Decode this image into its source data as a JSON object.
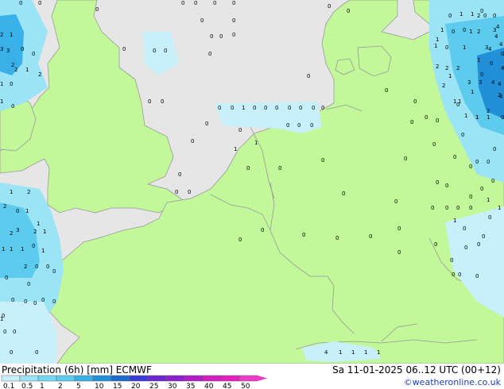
{
  "map": {
    "sea_color": "#e6e6e6",
    "land_color": "#c2f79a",
    "border_color": "#999999",
    "precip_colors": [
      "#c8f0fa",
      "#9be4f5",
      "#5ccbee",
      "#3ab0e8",
      "#2190d8"
    ],
    "values": [
      "0",
      "0",
      "0",
      "0",
      "0",
      "0",
      "0",
      "0",
      "0",
      "0",
      "0",
      "0",
      "0",
      "0",
      "0",
      "0",
      "0",
      "0",
      "0",
      "0",
      "0",
      "1",
      "1",
      "0",
      "0",
      "2",
      "1",
      "3",
      "2",
      "0",
      "0",
      "3",
      "2",
      "1",
      "2",
      "1",
      "0",
      "1",
      "0",
      "0",
      "0",
      "1",
      "0",
      "0",
      "0",
      "0",
      "0",
      "0",
      "0",
      "0",
      "0",
      "0",
      "0",
      "0",
      "0",
      "0",
      "0",
      "0",
      "0",
      "0",
      "0",
      "0",
      "0",
      "0",
      "0",
      "0",
      "0",
      "0",
      "1",
      "0",
      "0",
      "0",
      "0",
      "1",
      "0",
      "2",
      "1",
      "2",
      "1",
      "0",
      "1",
      "2",
      "0",
      "0",
      "0",
      "1",
      "1",
      "1",
      "0",
      "0",
      "0",
      "0",
      "0",
      "0",
      "0",
      "0",
      "0",
      "0",
      "0",
      "0",
      "0",
      "0",
      "0",
      "0",
      "1",
      "2",
      "1",
      "3",
      "2",
      "0",
      "0",
      "0",
      "1",
      "1",
      "0",
      "1",
      "0",
      "0",
      "0",
      "0",
      "0",
      "1",
      "2",
      "2",
      "4",
      "4",
      "1",
      "1",
      "0",
      "0",
      "0",
      "1",
      "1",
      "1",
      "0",
      "0",
      "0",
      "1",
      "1",
      "2",
      "2",
      "2",
      "3",
      "3",
      "4",
      "4",
      "4",
      "3",
      "1",
      "1",
      "1",
      "2",
      "4",
      "4",
      "2",
      "3",
      "1",
      "1",
      "2",
      "4",
      "0",
      "0",
      "0",
      "0",
      "0",
      "0",
      "0",
      "0",
      "0",
      "0",
      "0",
      "0",
      "0",
      "0",
      "0",
      "0",
      "0",
      "0",
      "0",
      "0",
      "4",
      "1",
      "1",
      "1",
      "1",
      "0",
      "1",
      "1"
    ]
  },
  "footer": {
    "title": "Precipitation (6h) [mm] ECMWF",
    "valid_time": "Sa 11-01-2025 06..12 UTC (00+12)",
    "credit": "©weatheronline.co.uk",
    "scale_labels": [
      "0.1",
      "0.5",
      "1",
      "2",
      "5",
      "10",
      "15",
      "20",
      "25",
      "30",
      "35",
      "40",
      "45",
      "50"
    ],
    "scale_colors": [
      "#c8f0fa",
      "#9be4f5",
      "#72d8f2",
      "#5ccbee",
      "#3ab0e8",
      "#2190d8",
      "#1c6cd0",
      "#3a3ad8",
      "#6a28d0",
      "#8c1ecc",
      "#b41cc8",
      "#d41ec4",
      "#e620c0",
      "#ee3ac8"
    ]
  }
}
